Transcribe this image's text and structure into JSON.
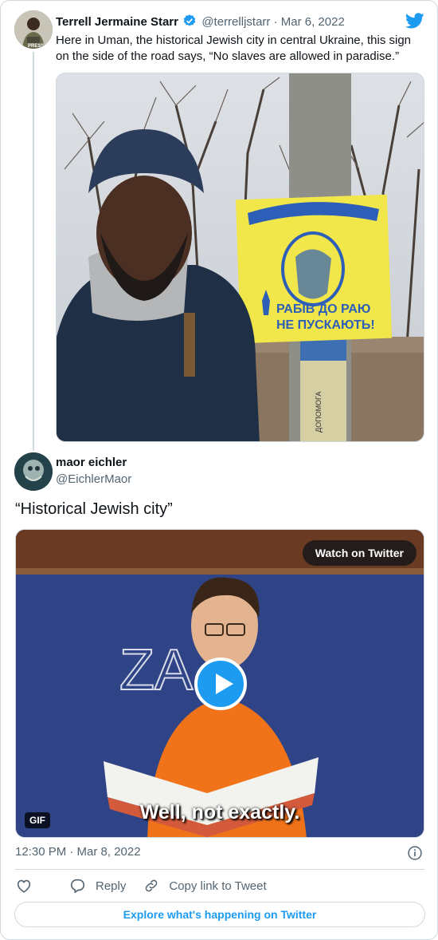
{
  "quoted_tweet": {
    "author_name": "Terrell Jermaine Starr",
    "author_handle": "@terrelljstarr",
    "separator": "·",
    "date": "Mar 6, 2022",
    "text": "Here in Uman, the historical Jewish city in central Ukraine, this sign on the side of the road says, “No slaves are allowed in paradise.”",
    "avatar_badge": "PRESS",
    "photo": {
      "sign_line1": "РАБІВ ДО РАЮ",
      "sign_line2": "НЕ ПУСКАЮТЬ!",
      "pole_text": "ДОПОМОГА"
    }
  },
  "tweet": {
    "author_name": "maor eichler",
    "author_handle": "@EichlerMaor",
    "text": "“Historical Jewish city”",
    "video": {
      "watch_label": "Watch on Twitter",
      "gif_label": "GIF",
      "subtitle": "Well, not exactly.",
      "board_text": "ZA K"
    },
    "timestamp": "12:30 PM · Mar 8, 2022"
  },
  "actions": {
    "reply_label": "Reply",
    "copy_link_label": "Copy link to Tweet"
  },
  "explore_label": "Explore what's happening on Twitter",
  "colors": {
    "accent": "#1d9bf0",
    "muted_text": "#536471",
    "border": "#cfd9de"
  }
}
